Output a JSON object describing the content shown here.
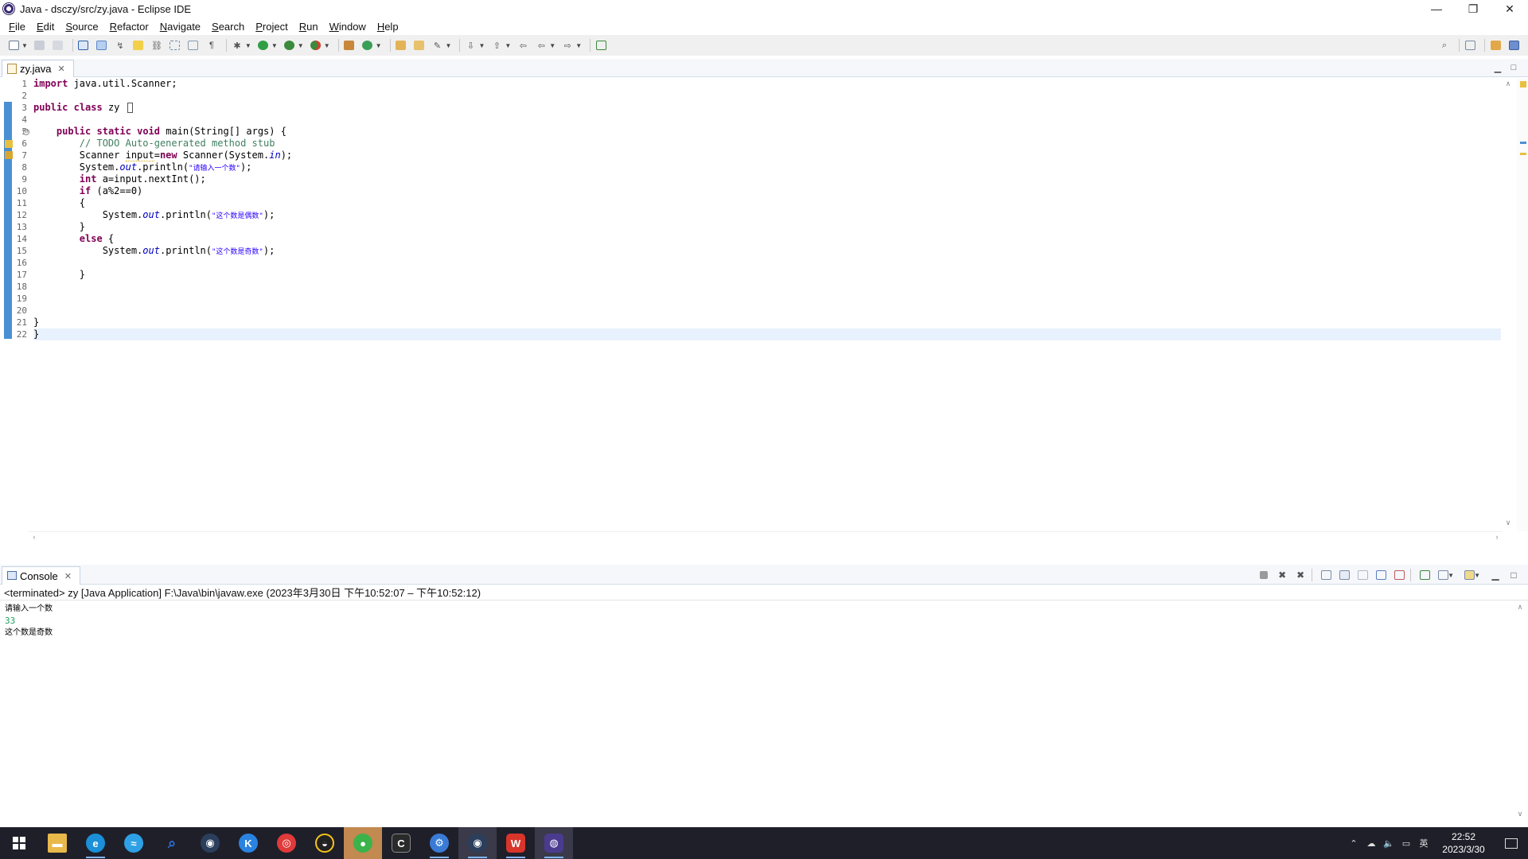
{
  "window": {
    "title": "Java - dsczy/src/zy.java - Eclipse IDE",
    "controls": {
      "minimize": "—",
      "restore": "❐",
      "close": "✕"
    }
  },
  "menu": [
    "File",
    "Edit",
    "Source",
    "Refactor",
    "Navigate",
    "Search",
    "Project",
    "Run",
    "Window",
    "Help"
  ],
  "editor": {
    "tab_label": "zy.java",
    "tab_close": "✕",
    "line_numbers": [
      "1",
      "2",
      "3",
      "4",
      "5",
      "6",
      "7",
      "8",
      "9",
      "10",
      "11",
      "12",
      "13",
      "14",
      "15",
      "16",
      "17",
      "18",
      "19",
      "20",
      "21",
      "22"
    ],
    "lines": {
      "l1": {
        "kw": "import",
        "rest": " java.util.Scanner;"
      },
      "l3": {
        "kw1": "public",
        "kw2": "class",
        "name": "zy"
      },
      "l5": {
        "kw1": "public",
        "kw2": "static",
        "kw3": "void",
        "rest": " main(String[] args) {"
      },
      "l6": {
        "comment": "// TODO Auto-generated method stub"
      },
      "l7": {
        "a": "Scanner ",
        "var": "input",
        "b": "=",
        "kw": "new",
        "c": " Scanner(System.",
        "fld": "in",
        "d": ");"
      },
      "l8": {
        "a": "System.",
        "fld": "out",
        "b": ".println(",
        "str": "\"请输入一个数\"",
        "c": ");"
      },
      "l9": {
        "kw": "int",
        "rest": " a=input.nextInt();"
      },
      "l10": {
        "kw": "if",
        "rest": " (a%2==0)"
      },
      "l11": {
        "text": "{"
      },
      "l12": {
        "a": "System.",
        "fld": "out",
        "b": ".println(",
        "str": "\"这个数是偶数\"",
        "c": ");"
      },
      "l13": {
        "text": "}"
      },
      "l14": {
        "kw": "else",
        "rest": " {"
      },
      "l15": {
        "a": "System.",
        "fld": "out",
        "b": ".println(",
        "str": "\"这个数是奇数\"",
        "c": ");"
      },
      "l17": {
        "text": "}"
      },
      "l21": {
        "text": "}"
      },
      "l22": {
        "text": "}"
      }
    },
    "fold_symbol": "⊖"
  },
  "console": {
    "tab_label": "Console",
    "tab_close": "✕",
    "header": "<terminated> zy [Java Application] F:\\Java\\bin\\javaw.exe  (2023年3月30日 下午10:52:07 – 下午10:52:12)",
    "output": [
      "请输入一个数",
      "33",
      "这个数是奇数"
    ]
  },
  "taskbar": {
    "apps": [
      {
        "name": "file-explorer",
        "glyph": "▬",
        "color": "#e8b84a"
      },
      {
        "name": "edge",
        "glyph": "e",
        "color": "#1b8fd8"
      },
      {
        "name": "photos",
        "glyph": "≈",
        "color": "#2ea0e6"
      },
      {
        "name": "search",
        "glyph": "⌕",
        "color": "#2f6fd6"
      },
      {
        "name": "steam",
        "glyph": "◉",
        "color": "#2b3f5c"
      },
      {
        "name": "kugou",
        "glyph": "K",
        "color": "#2a83e0"
      },
      {
        "name": "netease-music",
        "glyph": "◎",
        "color": "#e03a3a"
      },
      {
        "name": "qq",
        "glyph": "◒",
        "color": "#222222"
      },
      {
        "name": "wechat",
        "glyph": "●",
        "color": "#3bb34a"
      },
      {
        "name": "cursor-app",
        "glyph": "C",
        "color": "#2a2a2a"
      },
      {
        "name": "settings-tool",
        "glyph": "⚙",
        "color": "#3a7bd5"
      },
      {
        "name": "steam-2",
        "glyph": "◉",
        "color": "#2b3f5c"
      },
      {
        "name": "wps",
        "glyph": "W",
        "color": "#d9352b"
      },
      {
        "name": "eclipse",
        "glyph": "◍",
        "color": "#4b3b8f"
      }
    ],
    "tray_icons": [
      "⌃",
      "☁",
      "🔈",
      "▭",
      "英"
    ],
    "time": "22:52",
    "date": "2023/3/30"
  }
}
